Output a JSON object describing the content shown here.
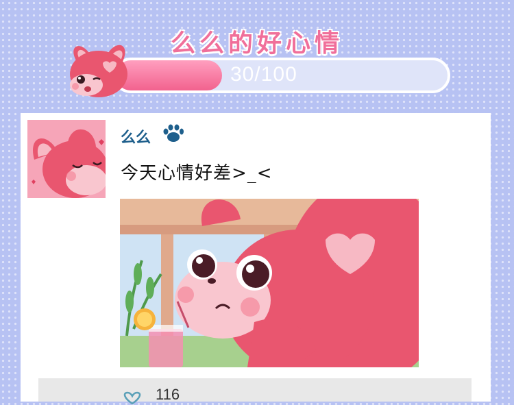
{
  "header": {
    "title": "么么的好心情",
    "progress_text": "30/100",
    "progress_fraction": 0.3
  },
  "post": {
    "username": "么么",
    "text": "今天心情好差>_<",
    "like_count": "116"
  },
  "colors": {
    "background": "#b7c2f3",
    "accent_pink": "#f06f9a",
    "username_blue": "#1e5f8c"
  },
  "icons": [
    "paw-icon",
    "heart-outline-icon"
  ]
}
